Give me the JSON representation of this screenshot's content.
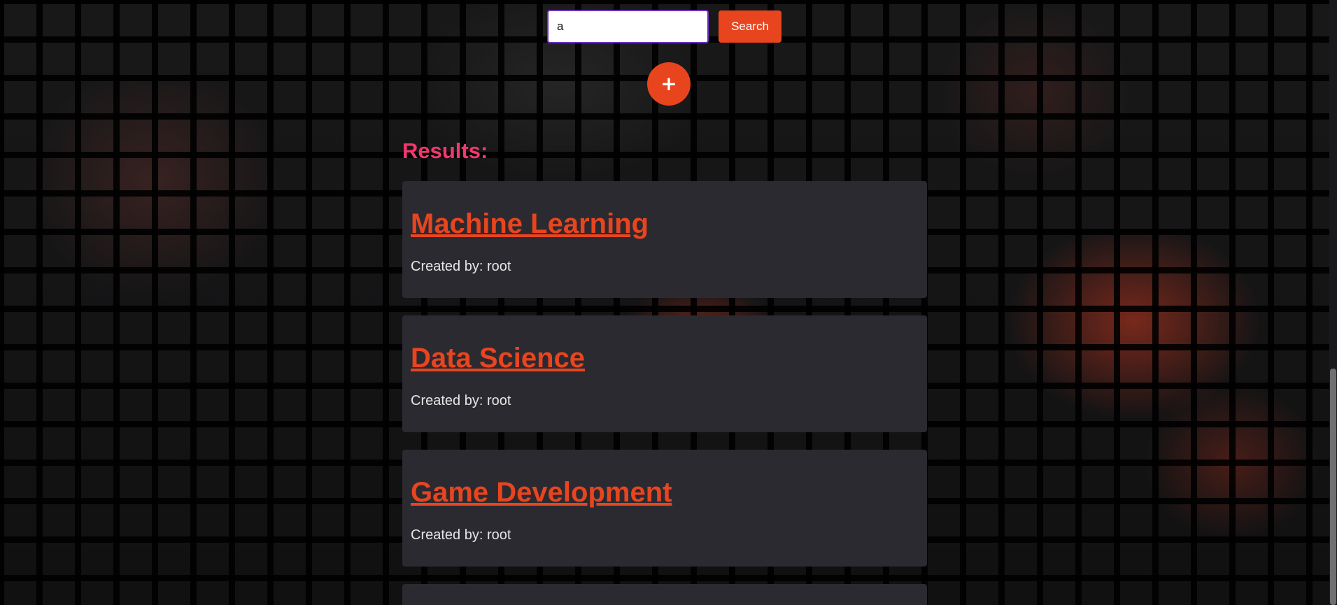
{
  "search": {
    "value": "a",
    "button_label": "Search"
  },
  "add_button": {
    "label": "+"
  },
  "results": {
    "heading": "Results:",
    "items": [
      {
        "title": "Machine Learning",
        "created_by": "Created by: root"
      },
      {
        "title": "Data Science",
        "created_by": "Created by: root"
      },
      {
        "title": "Game Development",
        "created_by": "Created by: root"
      }
    ]
  },
  "colors": {
    "accent": "#e8451f",
    "heading": "#f2386f",
    "card_background": "#2b2a31",
    "input_border": "#6b2fc0"
  }
}
